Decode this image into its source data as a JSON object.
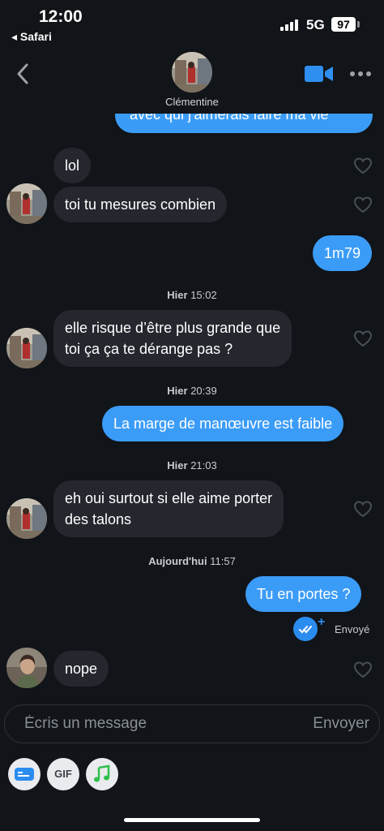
{
  "status": {
    "time": "12:00",
    "back_app": "◂ Safari",
    "network": "5G",
    "battery": "97"
  },
  "header": {
    "contact_name": "Clémentine"
  },
  "messages": {
    "m0": "avec qui j'aimerais faire ma vie",
    "m1": "lol",
    "m2": "toi tu mesures combien",
    "m3": "1m79",
    "ts1_day": "Hier",
    "ts1_time": "15:02",
    "m4_line1": "elle risque d’être plus grande que",
    "m4_line2": "toi ça ça te dérange pas ?",
    "ts2_day": "Hier",
    "ts2_time": "20:39",
    "m5": "La marge de manœuvre est faible",
    "ts3_day": "Hier",
    "ts3_time": "21:03",
    "m6_line1": "eh oui surtout si elle aime porter",
    "m6_line2": "des talons",
    "ts4_day": "Aujourd'hui",
    "ts4_time": "11:57",
    "m7": "Tu en portes ?",
    "sent_status": "Envoyé",
    "m8": "nope"
  },
  "composer": {
    "placeholder": "Écris un message",
    "send_label": "Envoyer"
  },
  "toolbar": {
    "gif_label": "GIF"
  },
  "colors": {
    "background": "#111418",
    "incoming_bubble": "#24272e",
    "outgoing_bubble": "#3b9cf7",
    "accent": "#2b8cf0"
  },
  "icons": [
    "chevron-left-icon",
    "video-camera-icon",
    "more-dots-icon",
    "heart-icon",
    "double-check-icon",
    "card-icon",
    "music-note-icon"
  ]
}
